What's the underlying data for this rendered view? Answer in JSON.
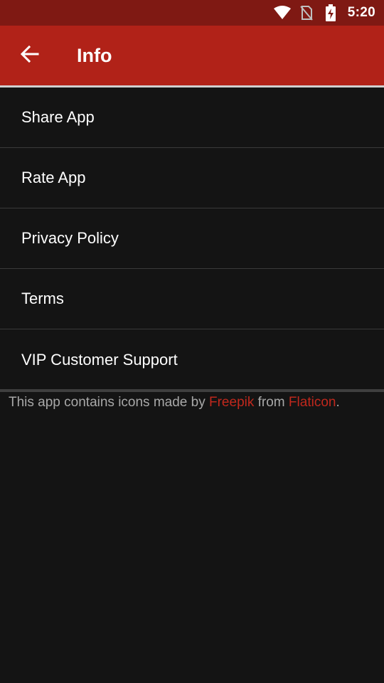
{
  "status_bar": {
    "time": "5:20",
    "icons": [
      "wifi-icon",
      "no-sim-icon",
      "battery-charging-icon"
    ]
  },
  "app_bar": {
    "title": "Info",
    "back_icon": "arrow-left-icon"
  },
  "menu": {
    "items": [
      {
        "label": "Share App"
      },
      {
        "label": "Rate App"
      },
      {
        "label": "Privacy Policy"
      },
      {
        "label": "Terms"
      },
      {
        "label": "VIP Customer Support"
      }
    ]
  },
  "credits": {
    "prefix": "This app contains icons made by ",
    "author_link": "Freepik",
    "middle": " from ",
    "source_link": "Flaticon",
    "suffix": "."
  },
  "colors": {
    "status_bar": "#7f1913",
    "app_bar": "#b12218",
    "background": "#141414",
    "link": "#c0281d"
  }
}
